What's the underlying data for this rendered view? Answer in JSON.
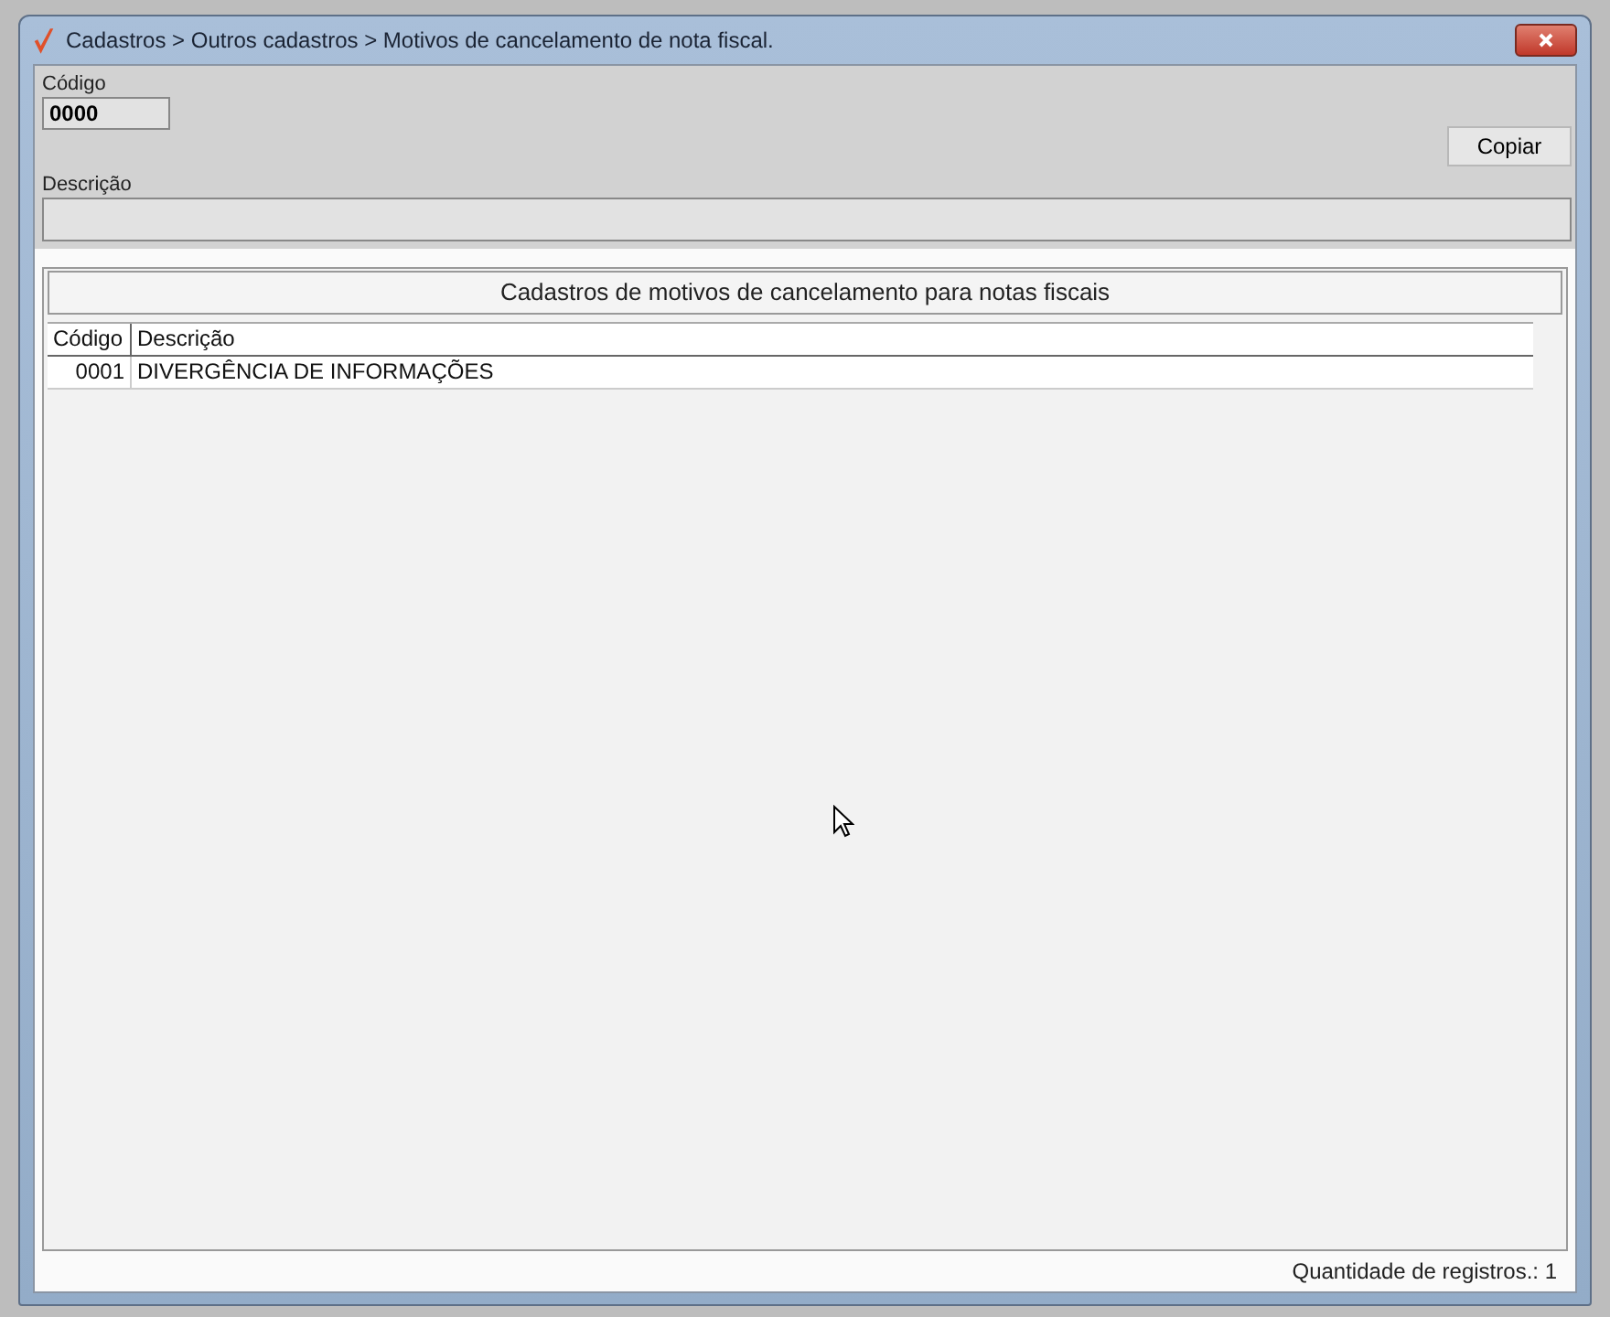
{
  "window": {
    "title": "Cadastros > Outros cadastros > Motivos de cancelamento de nota fiscal."
  },
  "form": {
    "code_label": "Código",
    "code_value": "0000",
    "description_label": "Descrição",
    "copy_button": "Copiar"
  },
  "grid": {
    "title": "Cadastros de motivos de cancelamento para notas fiscais",
    "columns": [
      "Código",
      "Descrição"
    ],
    "rows": [
      [
        "0001",
        "DIVERGÊNCIA DE INFORMAÇÕES"
      ]
    ]
  },
  "status_bar": "Quantidade de registros.: 1"
}
